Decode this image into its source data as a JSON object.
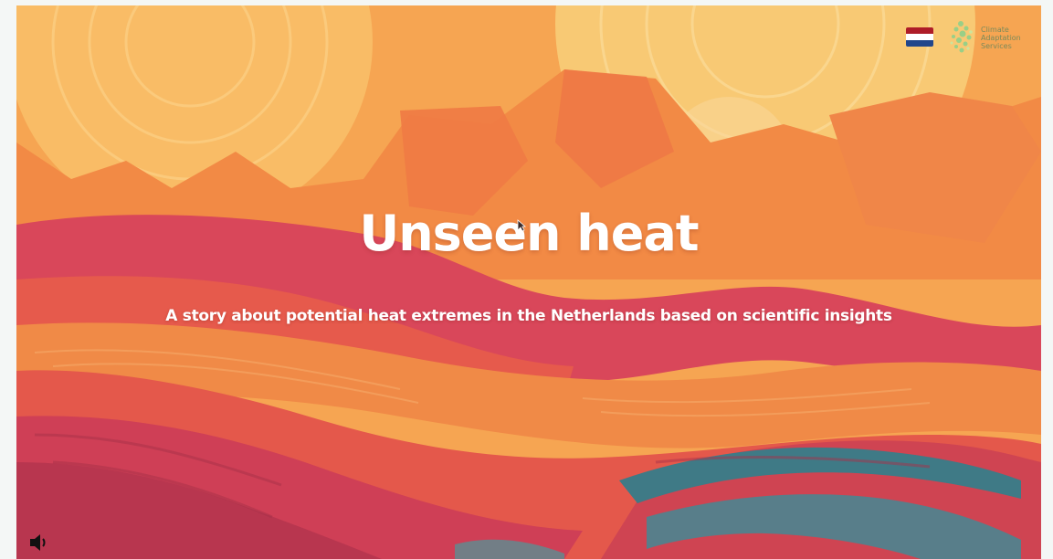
{
  "hero": {
    "title": "Unseen heat",
    "subtitle": "A story about potential heat extremes in the Netherlands based on scientific insights"
  },
  "header": {
    "language_flag": {
      "icon": "netherlands-flag-icon",
      "colors": [
        "#ae1c28",
        "#ffffff",
        "#21468b"
      ]
    },
    "logo": {
      "icon": "climate-adaptation-logo-icon",
      "lines": [
        "Climate",
        "Adaptation",
        "Services"
      ],
      "color": "#7a8a5a"
    }
  },
  "controls": {
    "sound_icon": "speaker-icon"
  },
  "palette": {
    "sky": "#f7b15a",
    "sun": "#f9d98a",
    "orange": "#f28a45",
    "coral": "#e85d4a",
    "crimson": "#d44458",
    "teal": "#3f7a86"
  }
}
